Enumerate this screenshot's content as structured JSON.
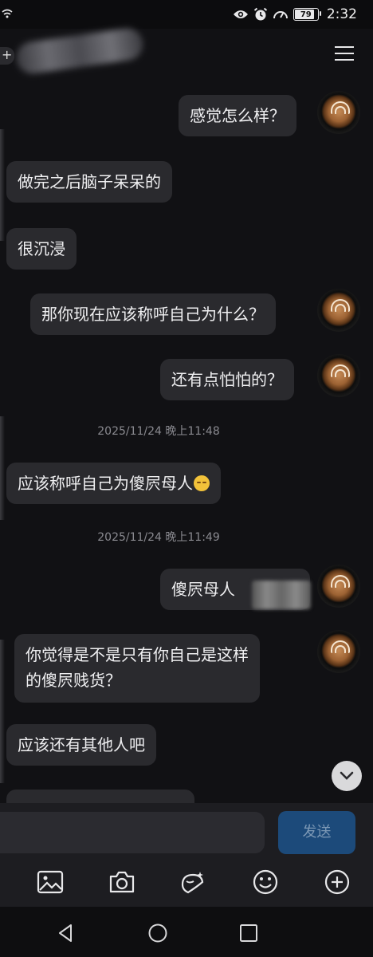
{
  "status_bar": {
    "time": "2:32",
    "battery": "79",
    "icons": [
      "wifi-icon",
      "eye-icon",
      "alarm-icon",
      "speedometer-icon",
      "battery-icon"
    ]
  },
  "header": {
    "back_label": "+",
    "menu_icon": "menu-icon"
  },
  "messages": [
    {
      "side": "right",
      "text": "感觉怎么样？"
    },
    {
      "side": "left",
      "text": "做完之后脑子呆呆的"
    },
    {
      "side": "left",
      "text": "很沉浸"
    },
    {
      "side": "right",
      "text": "那你现在应该称呼自己为什么？"
    },
    {
      "side": "right",
      "text": "还有点怕怕的？"
    },
    {
      "type": "timestamp",
      "text": "2025/11/24 晚上11:48"
    },
    {
      "side": "left",
      "text": "应该称呼自己为傻屄母人",
      "emoji": "relieved-face-emoji"
    },
    {
      "type": "timestamp",
      "text": "2025/11/24 晚上11:49"
    },
    {
      "side": "right",
      "text": "傻屄母人"
    },
    {
      "side": "right",
      "line1": "你觉得是不是只有你自己是这样",
      "line2": "的傻屄贱货？"
    },
    {
      "side": "left",
      "text": "应该还有其他人吧"
    }
  ],
  "input": {
    "send_label": "发送"
  },
  "toolbar": [
    "image-icon",
    "camera-icon",
    "sticker-icon",
    "emoji-icon",
    "plus-circle-icon"
  ],
  "navbar": [
    "back-triangle-icon",
    "home-circle-icon",
    "recents-square-icon"
  ],
  "colors": {
    "background": "#111114",
    "bubble": "#2a2a2e",
    "send_button": "#1c4a7a"
  }
}
